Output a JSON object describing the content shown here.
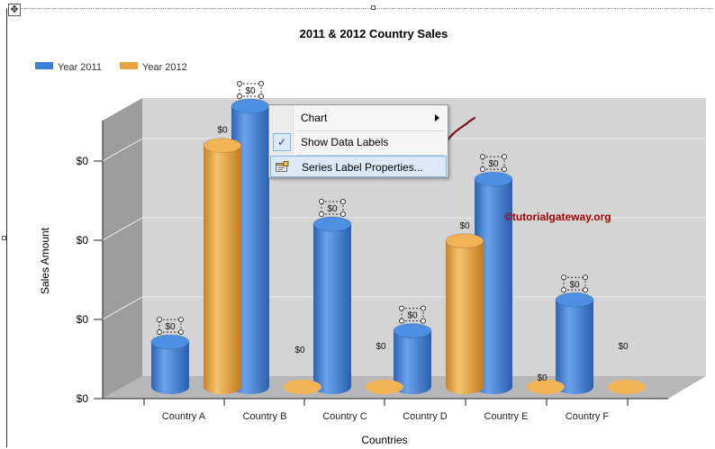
{
  "colors": {
    "year2011": "#3b7fd7",
    "year2012": "#e8a23e",
    "wall": "#d4d4d4",
    "floor": "#b7b7b7",
    "annotation": "#7a0f1e",
    "watermark": "#a00000",
    "menu_highlight": "#dceaf7"
  },
  "icons": {
    "move_handle": "move-arrows-icon",
    "checkmark": "checkmark-icon",
    "series_properties": "properties-icon",
    "submenu": "chevron-right-icon"
  },
  "chart_data": {
    "type": "bar",
    "title": "2011 & 2012 Country Sales",
    "xlabel": "Countries",
    "ylabel": "Sales Amount",
    "categories": [
      "Country A",
      "Country B",
      "Country C",
      "Country D",
      "Country E",
      "Country F"
    ],
    "y_tick_labels": [
      "$0",
      "$0",
      "$0",
      "$0"
    ],
    "grid": true,
    "three_d": true,
    "legend_position": "top-left",
    "series": [
      {
        "name": "Year 2011",
        "values": [
          16,
          100,
          58,
          20,
          74,
          31
        ],
        "data_labels": [
          "$0",
          "$0",
          "$0",
          "$0",
          "$0",
          "$0"
        ]
      },
      {
        "name": "Year 2012",
        "values": [
          86,
          0,
          0,
          52,
          0,
          0
        ],
        "data_labels": [
          "$0",
          "$0",
          "$0",
          "$0",
          "$0",
          "$0"
        ]
      }
    ],
    "watermark": "©tutorialgateway.org"
  },
  "context_menu": {
    "items": [
      {
        "label": "Chart",
        "has_submenu": true
      },
      {
        "label": "Show Data Labels",
        "checked": true
      },
      {
        "label": "Series Label Properties...",
        "highlighted": true
      }
    ]
  }
}
